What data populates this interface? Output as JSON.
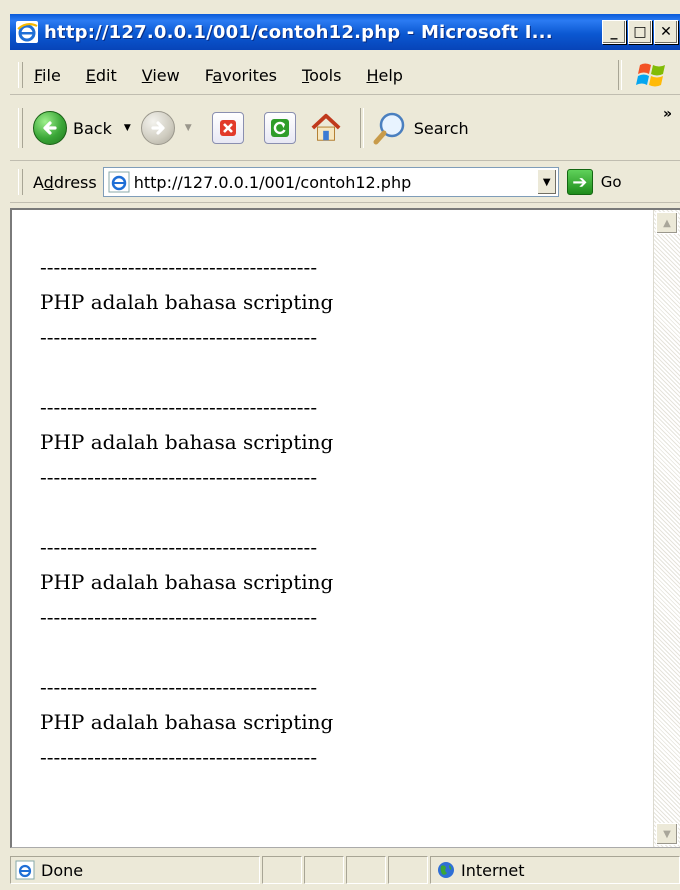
{
  "window": {
    "title": "http://127.0.0.1/001/contoh12.php - Microsoft I...",
    "minimize_label": "_",
    "maximize_label": "□",
    "close_label": "✕"
  },
  "menu": {
    "items": [
      {
        "pre": "",
        "key": "F",
        "post": "ile"
      },
      {
        "pre": "",
        "key": "E",
        "post": "dit"
      },
      {
        "pre": "",
        "key": "V",
        "post": "iew"
      },
      {
        "pre": "F",
        "key": "a",
        "post": "vorites"
      },
      {
        "pre": "",
        "key": "T",
        "post": "ools"
      },
      {
        "pre": "",
        "key": "H",
        "post": "elp"
      }
    ]
  },
  "toolbar": {
    "back_label": "Back",
    "search_label": "Search",
    "more_label": "»"
  },
  "address": {
    "label_pre": "A",
    "label_key": "d",
    "label_post": "dress",
    "url": "http://127.0.0.1/001/contoh12.php",
    "go_label": "Go"
  },
  "page": {
    "blocks": [
      {
        "top_rule": "-----------------------------------------",
        "text": "PHP adalah bahasa scripting",
        "bottom_rule": "-----------------------------------------"
      },
      {
        "top_rule": "-----------------------------------------",
        "text": "PHP adalah bahasa scripting",
        "bottom_rule": "-----------------------------------------"
      },
      {
        "top_rule": "-----------------------------------------",
        "text": "PHP adalah bahasa scripting",
        "bottom_rule": "-----------------------------------------"
      },
      {
        "top_rule": "-----------------------------------------",
        "text": "PHP adalah bahasa scripting",
        "bottom_rule": "-----------------------------------------"
      }
    ]
  },
  "status": {
    "text": "Done",
    "zone": "Internet"
  },
  "colors": {
    "titlebar": "#0a5ad8",
    "chrome": "#ece9d8"
  }
}
